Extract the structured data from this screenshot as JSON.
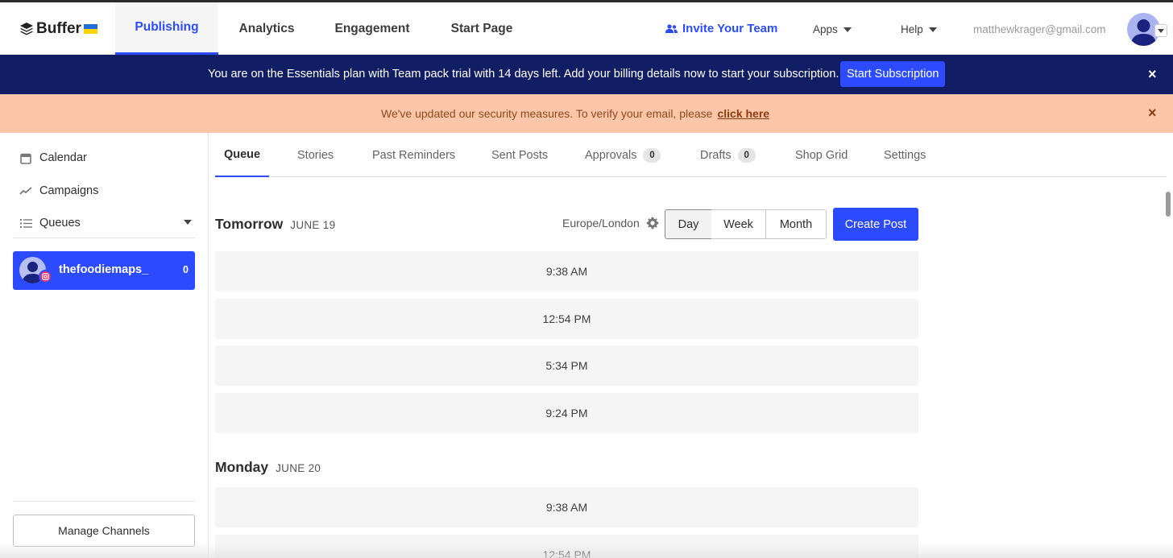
{
  "app": {
    "logo_text": "Buffer",
    "accent_color": "#2c4bff",
    "flag_colors": [
      "#1f6fd6",
      "#ffd500"
    ]
  },
  "nav": {
    "tabs": [
      {
        "label": "Publishing",
        "active": true
      },
      {
        "label": "Analytics",
        "active": false
      },
      {
        "label": "Engagement",
        "active": false
      },
      {
        "label": "Start Page",
        "active": false
      }
    ],
    "invite_label": "Invite Your Team",
    "apps_label": "Apps",
    "help_label": "Help",
    "user_email": "matthewkrager@gmail.com"
  },
  "banners": {
    "trial_message": "You are on the Essentials plan with Team pack trial with 14 days left. Add your billing details now to start your subscription.",
    "trial_button": "Start Subscription",
    "trial_bg": "#121e63",
    "security_message": "We've updated our security measures. To verify your email, please",
    "security_link": "click here",
    "security_bg": "#fdc6a8",
    "close_glyph": "×"
  },
  "sidebar": {
    "items": [
      {
        "label": "Calendar",
        "icon": "calendar-icon"
      },
      {
        "label": "Campaigns",
        "icon": "trend-icon"
      },
      {
        "label": "Queues",
        "icon": "list-icon"
      }
    ],
    "channel": {
      "name": "thefoodiemaps_",
      "count": "0",
      "network_icon": "instagram-icon"
    },
    "manage_label": "Manage Channels"
  },
  "subtabs": {
    "items": [
      {
        "label": "Queue",
        "active": true,
        "badge": null
      },
      {
        "label": "Stories",
        "active": false,
        "badge": null
      },
      {
        "label": "Past Reminders",
        "active": false,
        "badge": null
      },
      {
        "label": "Sent Posts",
        "active": false,
        "badge": null
      },
      {
        "label": "Approvals",
        "active": false,
        "badge": "0"
      },
      {
        "label": "Drafts",
        "active": false,
        "badge": "0"
      },
      {
        "label": "Shop Grid",
        "active": false,
        "badge": null
      },
      {
        "label": "Settings",
        "active": false,
        "badge": null
      }
    ]
  },
  "queue": {
    "timezone": "Europe/London",
    "view_options": [
      "Day",
      "Week",
      "Month"
    ],
    "selected_view": "Day",
    "create_label": "Create Post",
    "days": [
      {
        "label": "Tomorrow",
        "date": "JUNE 19",
        "slots": [
          "9:38 AM",
          "12:54 PM",
          "5:34 PM",
          "9:24 PM"
        ]
      },
      {
        "label": "Monday",
        "date": "JUNE 20",
        "slots": [
          "9:38 AM",
          "12:54 PM"
        ]
      }
    ]
  }
}
